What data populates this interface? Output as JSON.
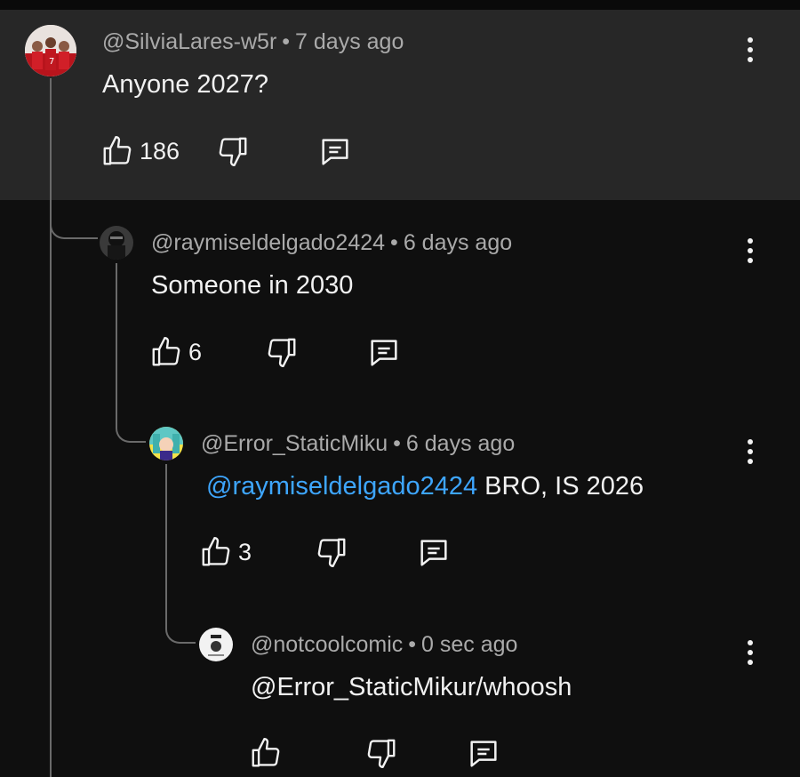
{
  "comments": [
    {
      "author": "@SilviaLares-w5r",
      "time": "7 days ago",
      "text": "Anyone 2027?",
      "likes": "186",
      "avatar_colors": [
        "#b8141c",
        "#e9e2de"
      ]
    },
    {
      "author": "@raymiseldelgado2424",
      "time": "6 days ago",
      "text": "Someone in 2030",
      "likes": "6",
      "avatar_colors": [
        "#1a1a1a",
        "#555555"
      ]
    },
    {
      "author": "@Error_StaticMiku",
      "time": "6 days ago",
      "mention": "@raymiseldelgado2424",
      "text": " BRO, IS 2026",
      "likes": "3",
      "avatar_colors": [
        "#5ec7c4",
        "#f3e24a"
      ]
    },
    {
      "author": "@notcoolcomic",
      "time": "0 sec ago",
      "text": "@Error_StaticMikur/whoosh",
      "likes": "",
      "avatar_colors": [
        "#f2f2f2",
        "#222222"
      ]
    }
  ],
  "separator": "•",
  "icons": {
    "like": "thumbs-up-icon",
    "dislike": "thumbs-down-icon",
    "reply": "reply-icon",
    "menu": "more-vert-icon"
  },
  "colors": {
    "background": "#0f0f0f",
    "highlight": "#272727",
    "mention": "#3ea6ff",
    "meta": "#aaaaaa"
  }
}
